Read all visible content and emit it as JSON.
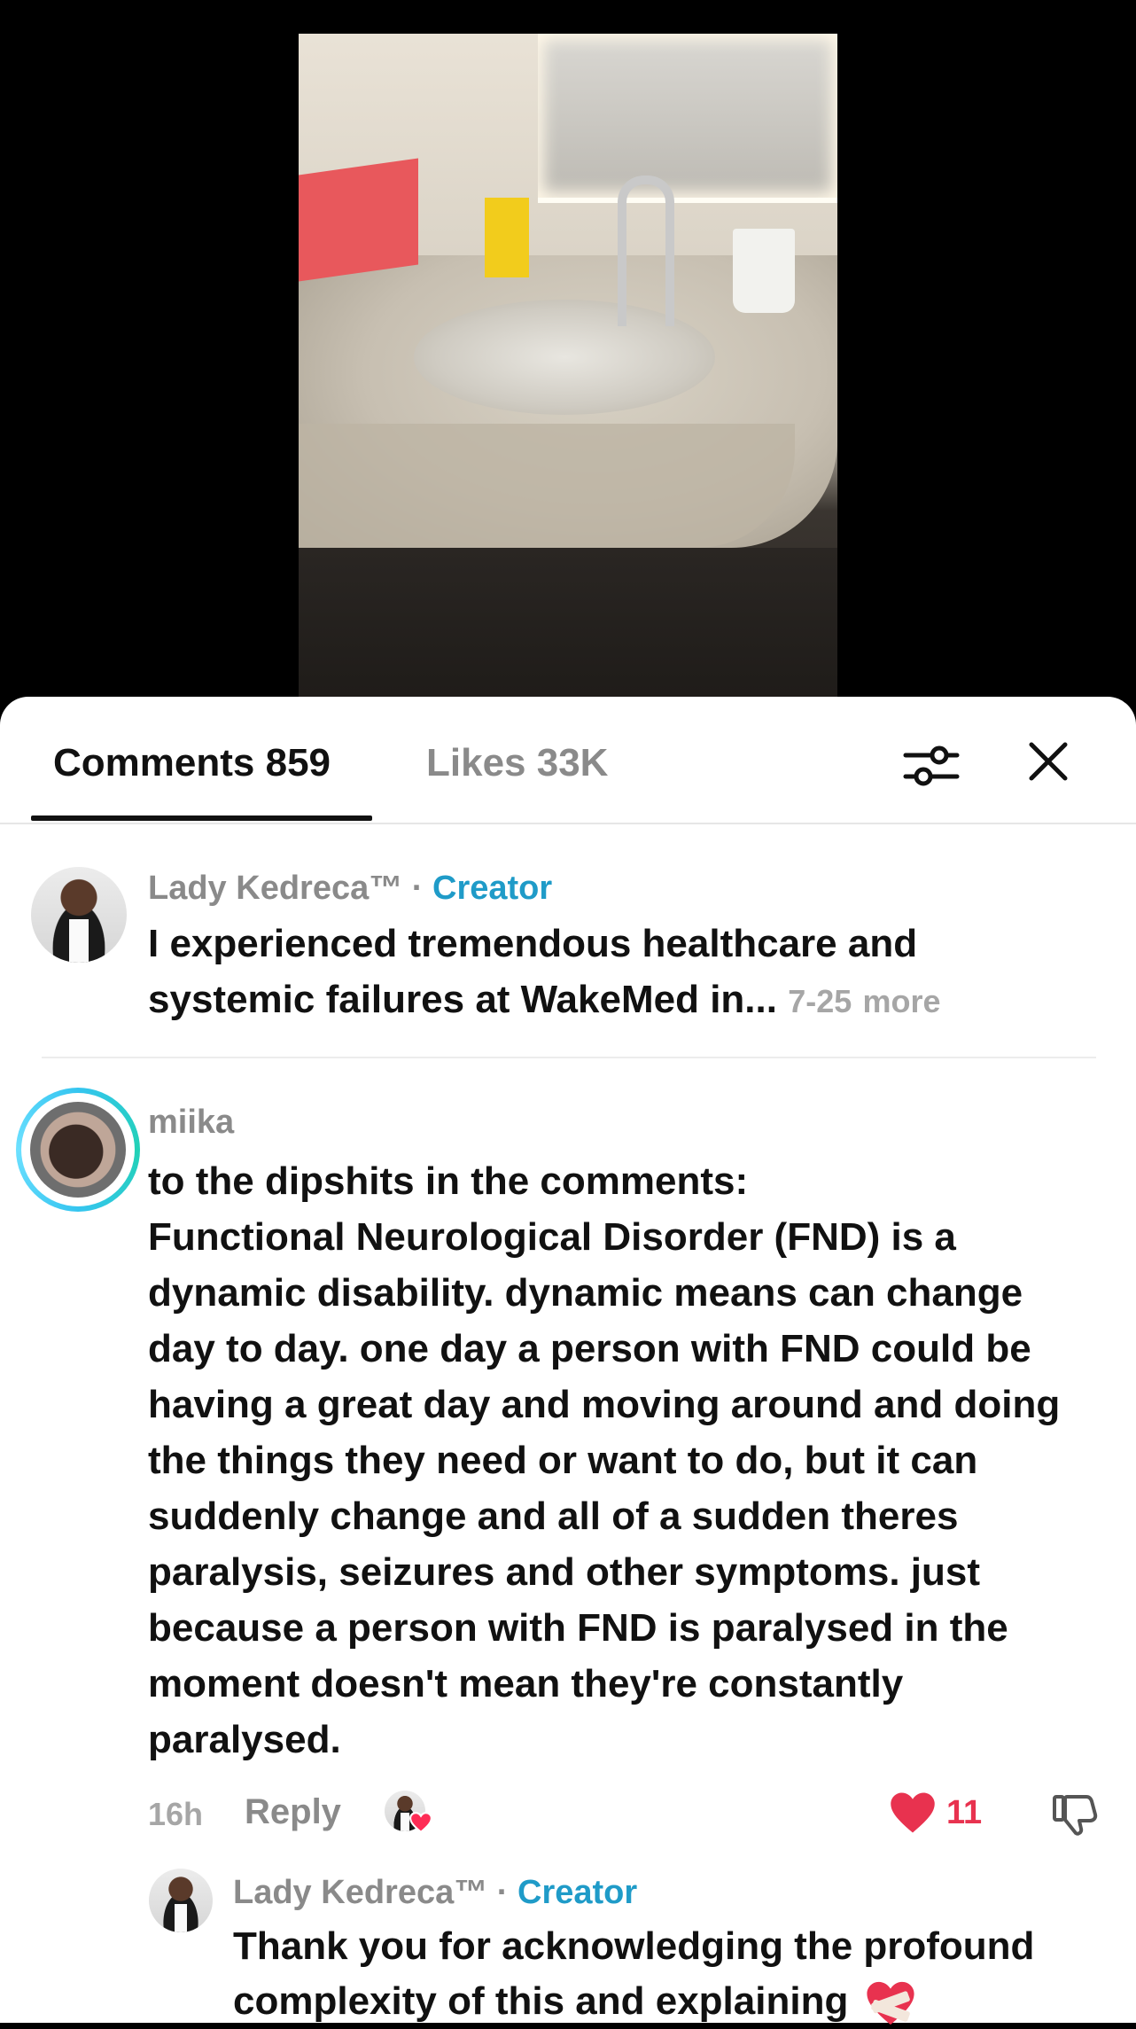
{
  "tabs": {
    "comments_label": "Comments 859",
    "likes_label": "Likes 33K"
  },
  "icons": {
    "filter": "sliders-icon",
    "close": "close-icon",
    "like": "heart-icon",
    "dislike": "thumbs-down-icon"
  },
  "colors": {
    "creator": "#1f9bc8",
    "like": "#e8324f",
    "muted": "#8a8a8a"
  },
  "comments": [
    {
      "username": "Lady Kedreca™",
      "separator": "·",
      "badge": "Creator",
      "text_line1": "I experienced tremendous healthcare and",
      "text_line2": "systemic failures at WakeMed in...",
      "date": "7-25",
      "more": "more"
    },
    {
      "username": "miika",
      "lines": [
        "to the dipshits in the comments:",
        "Functional Neurological Disorder (FND) is a",
        "dynamic disability. dynamic means can change",
        "day to day. one day a person with FND could be",
        "having a great day and moving around and doing",
        "the things they need or want to do, but it can",
        "suddenly change and all of a sudden theres",
        "paralysis, seizures and other symptoms. just",
        "because a person with FND is paralysed in the",
        "moment doesn't mean they're constantly",
        "paralysed."
      ],
      "time": "16h",
      "reply_label": "Reply",
      "like_count": "11"
    }
  ],
  "reply": {
    "username": "Lady Kedreca™",
    "separator": "·",
    "badge": "Creator",
    "text_line1": "Thank you for acknowledging the profound",
    "text_line2": "complexity of this and explaining"
  }
}
